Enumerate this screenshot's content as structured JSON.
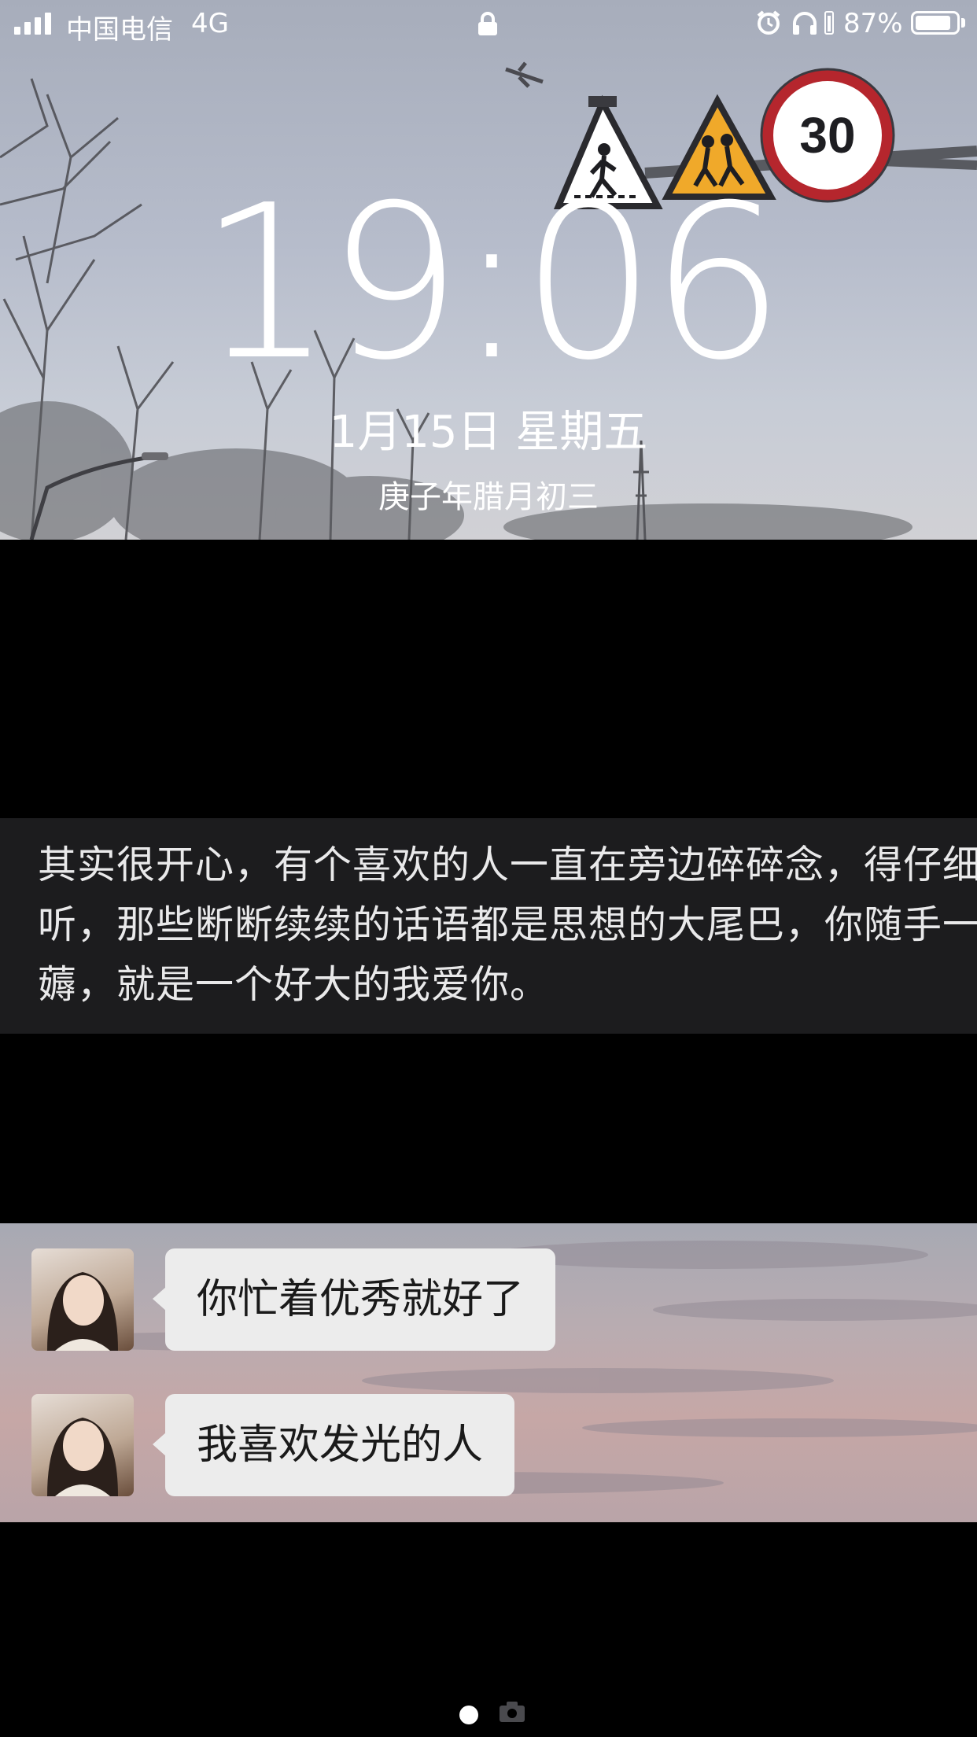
{
  "status_bar": {
    "carrier": "中国电信",
    "network": "4G",
    "battery_percent": "87%",
    "battery_level": 0.87,
    "icons": [
      "signal-icon",
      "lock-icon",
      "alarm-icon",
      "headphones-icon",
      "battery-icon"
    ]
  },
  "lockscreen": {
    "time": "19:06",
    "date": "1月15日 星期五",
    "lunar_date": "庚子年腊月初三"
  },
  "message": {
    "text": "其实很开心，有个喜欢的人一直在旁边碎碎念，得仔细听，那些断断续续的话语都是思想的大尾巴，你随手一薅，就是一个好大的我爱你。"
  },
  "chat": {
    "messages": [
      {
        "text": "你忙着优秀就好了"
      },
      {
        "text": "我喜欢发光的人"
      }
    ]
  },
  "page_indicator": {
    "current": 1,
    "icons": [
      "page-dot",
      "camera-icon"
    ]
  }
}
